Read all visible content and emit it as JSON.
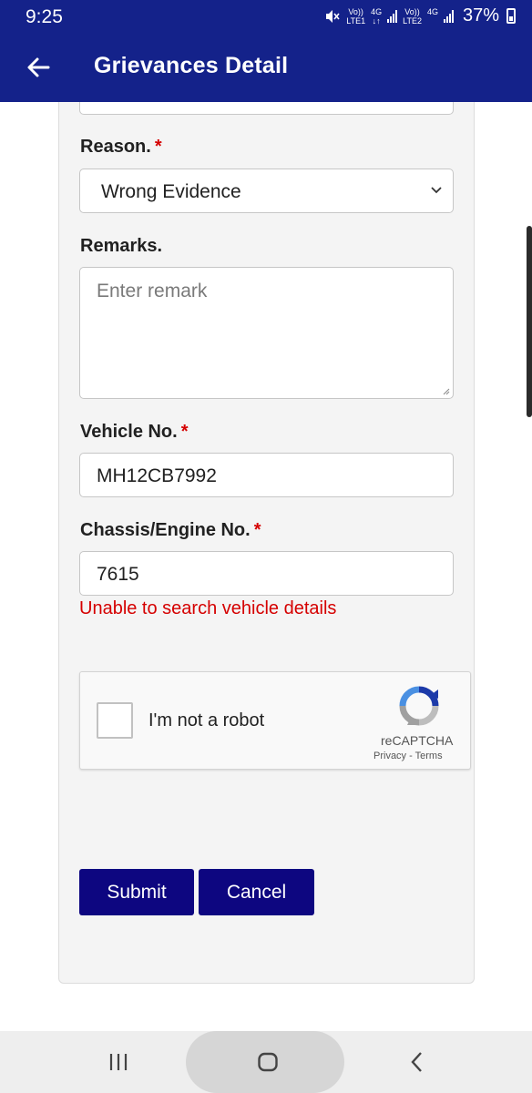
{
  "status_bar": {
    "time": "9:25",
    "sim1_top": "Vo))",
    "sim1_bottom": "LTE1",
    "sim1_net": "4G",
    "sim2_top": "Vo))",
    "sim2_bottom": "LTE2",
    "sim2_net": "4G",
    "battery": "37%"
  },
  "app_bar": {
    "title": "Grievances Detail",
    "back_icon": "arrow-left-icon"
  },
  "form": {
    "reason": {
      "label": "Reason.",
      "required_mark": "*",
      "selected": "Wrong Evidence"
    },
    "remarks": {
      "label": "Remarks.",
      "placeholder": "Enter remark"
    },
    "vehicle": {
      "label": "Vehicle No.",
      "required_mark": "*",
      "value": "MH12CB7992"
    },
    "chassis": {
      "label": "Chassis/Engine No.",
      "required_mark": "*",
      "value": "7615",
      "error": "Unable to search vehicle details"
    },
    "recaptcha": {
      "label": "I'm not a robot",
      "brand": "reCAPTCHA",
      "privacy": "Privacy",
      "separator": "-",
      "terms": "Terms"
    },
    "submit_label": "Submit",
    "cancel_label": "Cancel"
  },
  "colors": {
    "app_bar": "#14228a",
    "button": "#0d0680",
    "error": "#d50000",
    "required": "#d50000"
  }
}
